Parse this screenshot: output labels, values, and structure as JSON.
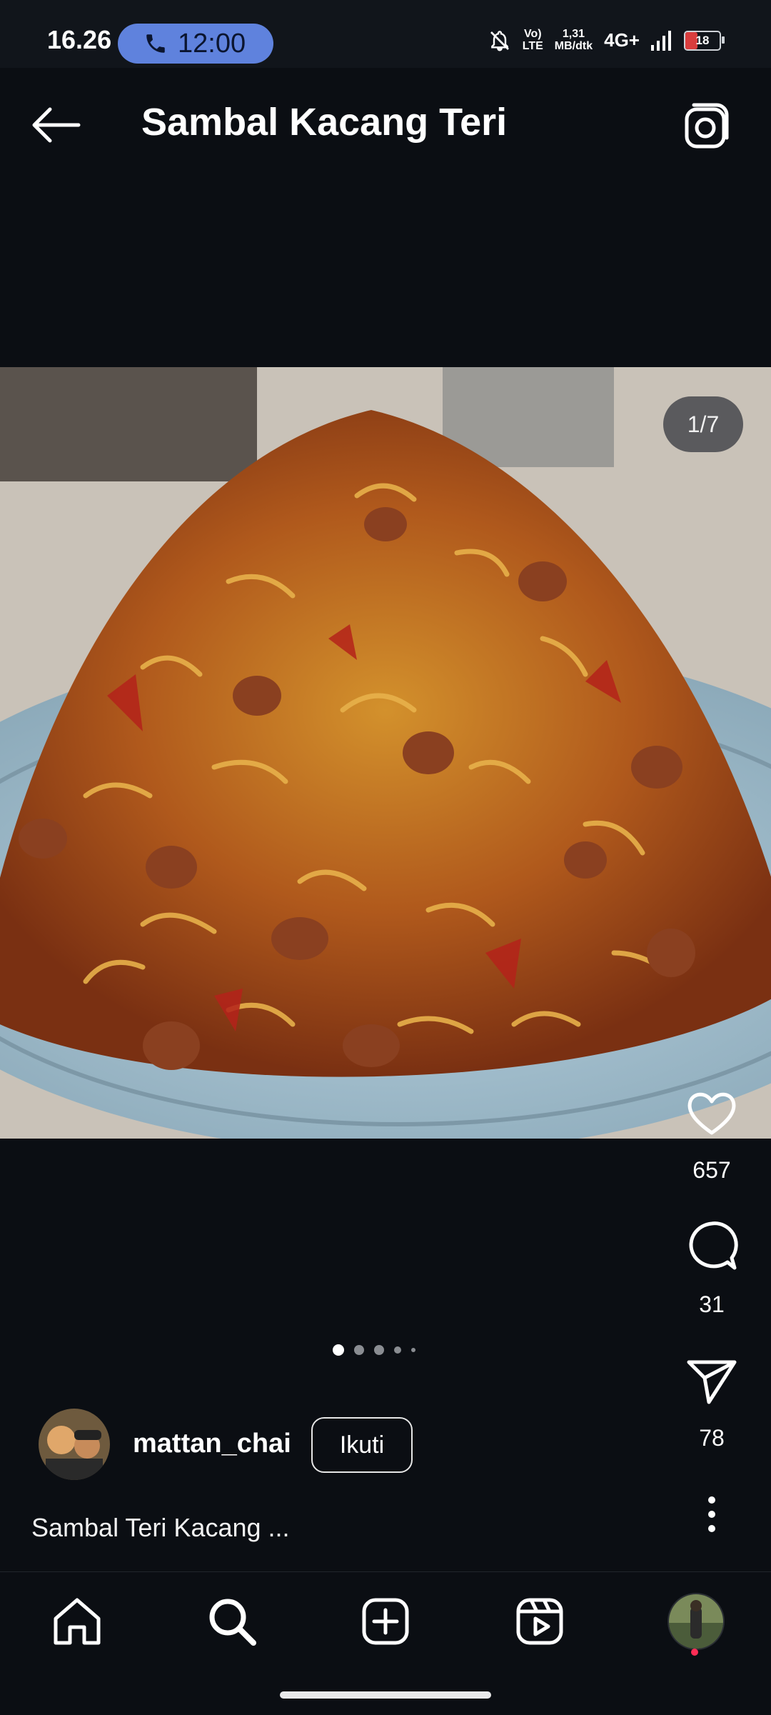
{
  "status_bar": {
    "time": "16.26",
    "call_timer": "12:00",
    "volte_top": "Vo)",
    "volte_bottom": "LTE",
    "speed_value": "1,31",
    "speed_unit": "MB/dtk",
    "network": "4G+",
    "battery": "18"
  },
  "header": {
    "title": "Sambal Kacang Teri"
  },
  "post": {
    "photo_counter": "1/7",
    "likes": "657",
    "comments": "31",
    "shares": "78",
    "carousel_position": 1,
    "carousel_total": 7
  },
  "author": {
    "username": "mattan_chai",
    "follow_label": "Ikuti"
  },
  "caption": "Sambal Teri Kacang ...",
  "nav": {
    "items": [
      "home-icon",
      "search-icon",
      "create-icon",
      "reels-icon",
      "profile-avatar"
    ],
    "active": "search-icon"
  },
  "colors": {
    "background": "#0b0e13",
    "call_pill": "#5f82dd",
    "notification": "#ff2d55"
  }
}
